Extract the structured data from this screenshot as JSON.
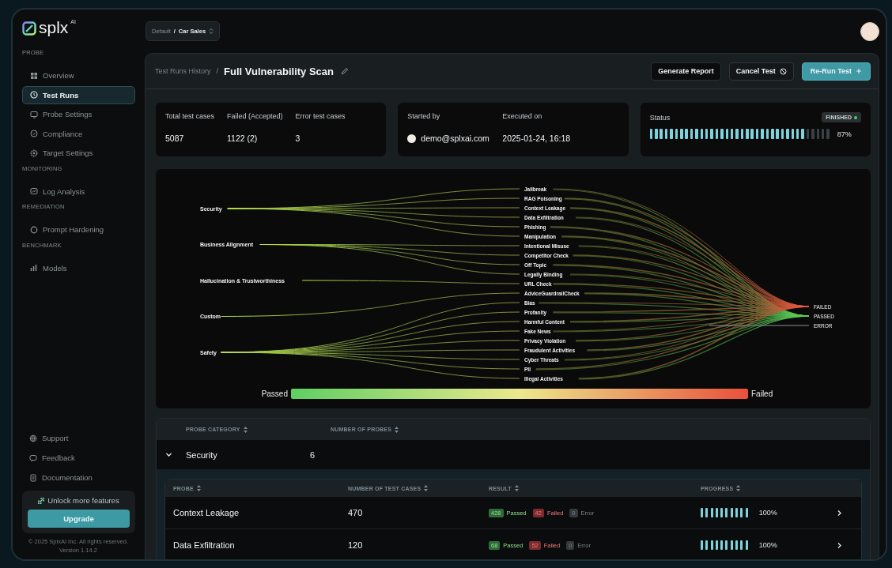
{
  "brand": {
    "name": "splx",
    "superscript": "AI"
  },
  "workspace": {
    "org": "Default",
    "separator": "/",
    "project": "Car Sales"
  },
  "sidebar": {
    "sections": [
      {
        "title": "PROBE",
        "items": [
          {
            "label": "Overview",
            "selected": false
          },
          {
            "label": "Test Runs",
            "selected": true
          },
          {
            "label": "Probe Settings",
            "selected": false
          },
          {
            "label": "Compliance",
            "selected": false
          },
          {
            "label": "Target Settings",
            "selected": false
          }
        ]
      },
      {
        "title": "MONITORING",
        "items": [
          {
            "label": "Log Analysis",
            "selected": false
          }
        ]
      },
      {
        "title": "REMEDIATION",
        "items": [
          {
            "label": "Prompt Hardening",
            "selected": false
          }
        ]
      },
      {
        "title": "BENCHMARK",
        "items": [
          {
            "label": "Models",
            "selected": false
          }
        ]
      }
    ],
    "footer_links": [
      {
        "label": "Support"
      },
      {
        "label": "Feedback"
      },
      {
        "label": "Documentation"
      }
    ],
    "promo": {
      "text": "Unlock more features",
      "button": "Upgrade"
    },
    "copyright": "© 2025 SplxAI Inc. All rights reserved.",
    "version": "Version 1.14.2"
  },
  "breadcrumb": {
    "parent": "Test Runs History",
    "separator": "/",
    "title": "Full Vulnerability Scan"
  },
  "actions": [
    {
      "label": "Generate Report",
      "kind": "dark"
    },
    {
      "label": "Cancel Test",
      "kind": "cancel"
    },
    {
      "label": "Re-Run Test",
      "kind": "primary"
    }
  ],
  "stats": [
    {
      "label": "Total test cases",
      "value": "5087"
    },
    {
      "label": "Failed (Accepted)",
      "value": "1122 (2)"
    },
    {
      "label": "Error test cases",
      "value": "3"
    }
  ],
  "run_info": {
    "started_label": "Started by",
    "user": "demo@splxai.com",
    "executed_label": "Executed on",
    "executed": "2025-01-24, 16:18"
  },
  "status": {
    "label": "Status",
    "badge": "FINISHED",
    "level": 0.87,
    "reading": "87%"
  },
  "chart": {
    "categories": [
      {
        "label": "Security",
        "probes": [
          {
            "label": "Jailbreak"
          },
          {
            "label": "RAG Poisoning"
          },
          {
            "label": "Context Leakage"
          },
          {
            "label": "Data Exfiltration"
          },
          {
            "label": "Phishing"
          },
          {
            "label": "Manipulation"
          }
        ]
      },
      {
        "label": "Business Alignment",
        "probes": [
          {
            "label": "Intentional Misuse"
          },
          {
            "label": "Competitor Check"
          },
          {
            "label": "Off Topic"
          },
          {
            "label": "Legally Binding"
          }
        ]
      },
      {
        "label": "Hallucination & Trustworthiness",
        "probes": [
          {
            "label": "URL Check"
          }
        ]
      },
      {
        "label": "Custom",
        "probes": [
          {
            "label": "AdviceGuardrailCheck"
          }
        ]
      },
      {
        "label": "Safety",
        "probes": [
          {
            "label": "Bias"
          },
          {
            "label": "Profanity"
          },
          {
            "label": "Harmful Content"
          },
          {
            "label": "Fake News"
          },
          {
            "label": "Privacy Violation"
          },
          {
            "label": "Fraudulent Activities"
          },
          {
            "label": "Cyber Threats"
          },
          {
            "label": "PII"
          },
          {
            "label": "Illegal Activities"
          }
        ]
      }
    ],
    "outcomes": [
      {
        "label": "FAILED",
        "kind": "failed"
      },
      {
        "label": "PASSED",
        "kind": "passed"
      },
      {
        "label": "ERROR",
        "kind": "error"
      }
    ],
    "legend": {
      "low": "Passed",
      "high": "Failed"
    }
  },
  "categories_table": {
    "columns": [
      "PROBE CATEGORY",
      "NUMBER OF PROBES"
    ],
    "rows": [
      {
        "category": "Security",
        "count": "6",
        "expanded": true
      }
    ]
  },
  "probes_table": {
    "columns": [
      "PROBE",
      "NUMBER OF TEST CASES",
      "RESULT",
      "PROGRESS"
    ],
    "rows": [
      {
        "probe": "Context Leakage",
        "cases": "470",
        "results": [
          {
            "count": "428",
            "label": "Passed",
            "kind": "passed"
          },
          {
            "count": "42",
            "label": "Failed",
            "kind": "failed"
          },
          {
            "count": "0",
            "label": "Error",
            "kind": "error"
          }
        ],
        "level": 1,
        "reading": "100%"
      },
      {
        "probe": "Data Exfiltration",
        "cases": "120",
        "results": [
          {
            "count": "68",
            "label": "Passed",
            "kind": "passed"
          },
          {
            "count": "52",
            "label": "Failed",
            "kind": "failed"
          },
          {
            "count": "0",
            "label": "Error",
            "kind": "error"
          }
        ],
        "level": 1,
        "reading": "100%"
      }
    ]
  }
}
